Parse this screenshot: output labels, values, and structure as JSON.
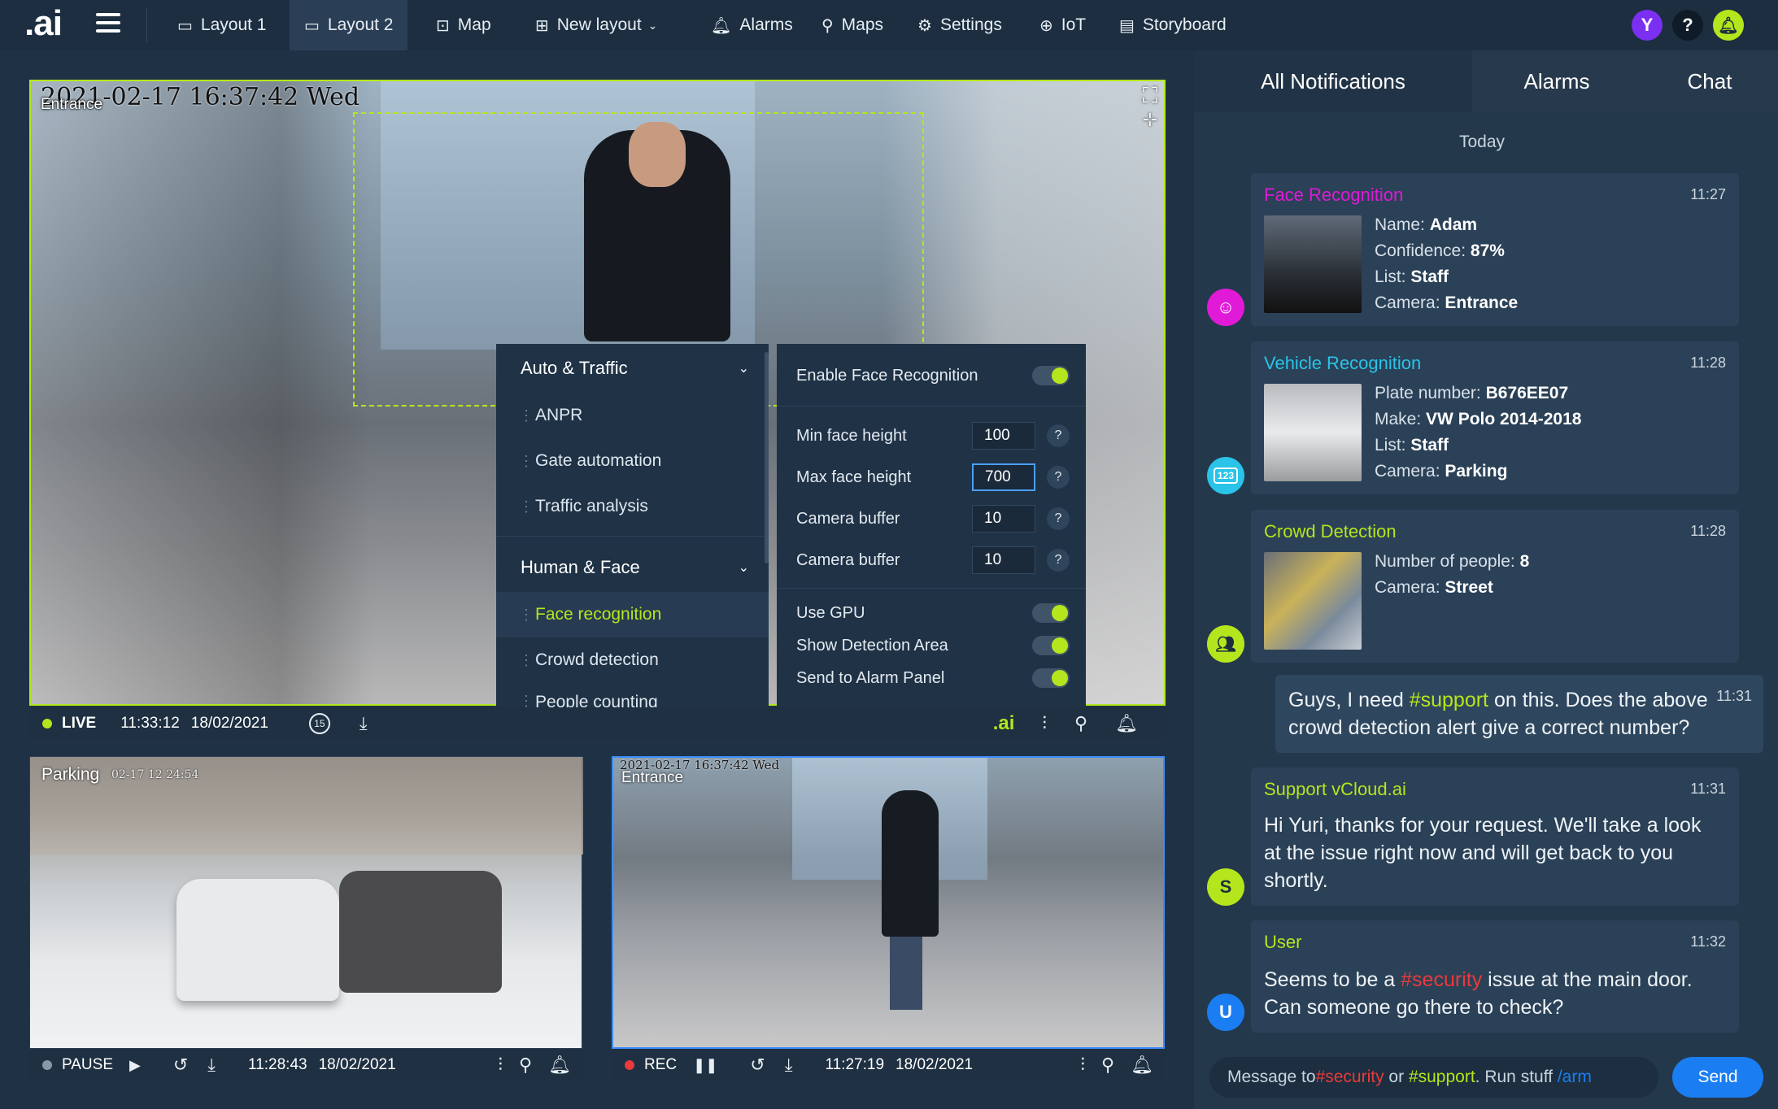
{
  "app": {
    "logo": ".ai"
  },
  "nav": {
    "items": [
      {
        "label": "Layout 1",
        "icon": "layout-icon"
      },
      {
        "label": "Layout 2",
        "icon": "layout-icon"
      },
      {
        "label": "Map",
        "icon": "map-icon"
      },
      {
        "label": "New layout",
        "icon": "plus-icon"
      },
      {
        "label": "Alarms",
        "icon": "bell-icon"
      },
      {
        "label": "Maps",
        "icon": "pin-icon"
      },
      {
        "label": "Settings",
        "icon": "gear-icon"
      },
      {
        "label": "IoT",
        "icon": "globe-icon"
      },
      {
        "label": "Storyboard",
        "icon": "film-icon"
      }
    ],
    "active": "Layout 2",
    "user_initial": "Y",
    "help": "?"
  },
  "main_camera": {
    "osd_datetime": "2021-02-17  16:37:42 Wed",
    "osd_name": "Entrance",
    "status": "LIVE",
    "time": "11:33:12",
    "date": "18/02/2021",
    "rewind": "15",
    "bar_logo": ".ai"
  },
  "feature_menu": {
    "group1": "Auto & Traffic",
    "group1_items": [
      "ANPR",
      "Gate automation",
      "Traffic analysis"
    ],
    "group2": "Human & Face",
    "group2_items": [
      "Face recognition",
      "Crowd detection",
      "People counting"
    ],
    "selected": "Face recognition"
  },
  "face_settings": {
    "enable_label": "Enable Face Recognition",
    "rows": [
      {
        "label": "Min face height",
        "value": "100"
      },
      {
        "label": "Max face height",
        "value": "700"
      },
      {
        "label": "Camera buffer",
        "value": "10"
      },
      {
        "label": "Camera buffer",
        "value": "10"
      }
    ],
    "toggles": [
      "Use GPU",
      "Show Detection Area",
      "Send to Alarm Panel"
    ],
    "help": "?"
  },
  "parking_camera": {
    "osd_name": "Parking",
    "osd_datetime": "02-17  12 24:54",
    "status": "PAUSE",
    "time": "11:28:43",
    "date": "18/02/2021"
  },
  "entrance_camera": {
    "osd_datetime": "2021-02-17  16:37:42 Wed",
    "osd_name": "Entrance",
    "status": "REC",
    "time": "11:27:19",
    "date": "18/02/2021"
  },
  "panel": {
    "tabs": [
      "All Notifications",
      "Alarms",
      "Chat"
    ],
    "today": "Today",
    "face": {
      "title": "Face Recognition",
      "time": "11:27",
      "lines": [
        {
          "k": "Name:",
          "v": "Adam"
        },
        {
          "k": "Confidence:",
          "v": "87%"
        },
        {
          "k": "List:",
          "v": "Staff"
        },
        {
          "k": "Camera:",
          "v": "Entrance"
        }
      ]
    },
    "vehicle": {
      "title": "Vehicle Recognition",
      "time": "11:28",
      "lines": [
        {
          "k": "Plate number:",
          "v": "B676EE07"
        },
        {
          "k": "Make:",
          "v": "VW Polo 2014-2018"
        },
        {
          "k": "List:",
          "v": "Staff"
        },
        {
          "k": "Camera:",
          "v": "Parking"
        }
      ],
      "icon_text": "123"
    },
    "crowd": {
      "title": "Crowd Detection",
      "time": "11:28",
      "lines": [
        {
          "k": "Number of people:",
          "v": "8"
        },
        {
          "k": "Camera:",
          "v": "Street"
        }
      ]
    },
    "msg_user": {
      "before": "Guys, I need ",
      "tag": "#support",
      "after": " on this. Does the above crowd detection alert give a correct number?",
      "time": "11:31"
    },
    "msg_support": {
      "title": "Support vCloud.ai",
      "time": "11:31",
      "text": "Hi Yuri, thanks for your request. We'll take a look at the issue right now and will get back to you shortly.",
      "avatar": "S"
    },
    "msg_user2": {
      "title": "User",
      "time": "11:32",
      "before": "Seems to be a ",
      "tag": "#security",
      "after": " issue at the main door. Can someone go there to check?",
      "avatar": "U"
    },
    "input": {
      "p1": "Message to ",
      "t1": "#security",
      "p2": " or ",
      "t2": "#support",
      "p3": ". Run stuff ",
      "t3": "/arm"
    },
    "send": "Send"
  },
  "colors": {
    "accent": "#b5e61d",
    "blue": "#1a7ef2",
    "magenta": "#e01ad6",
    "cyan": "#2ac4e8",
    "red": "#e83b3b"
  }
}
